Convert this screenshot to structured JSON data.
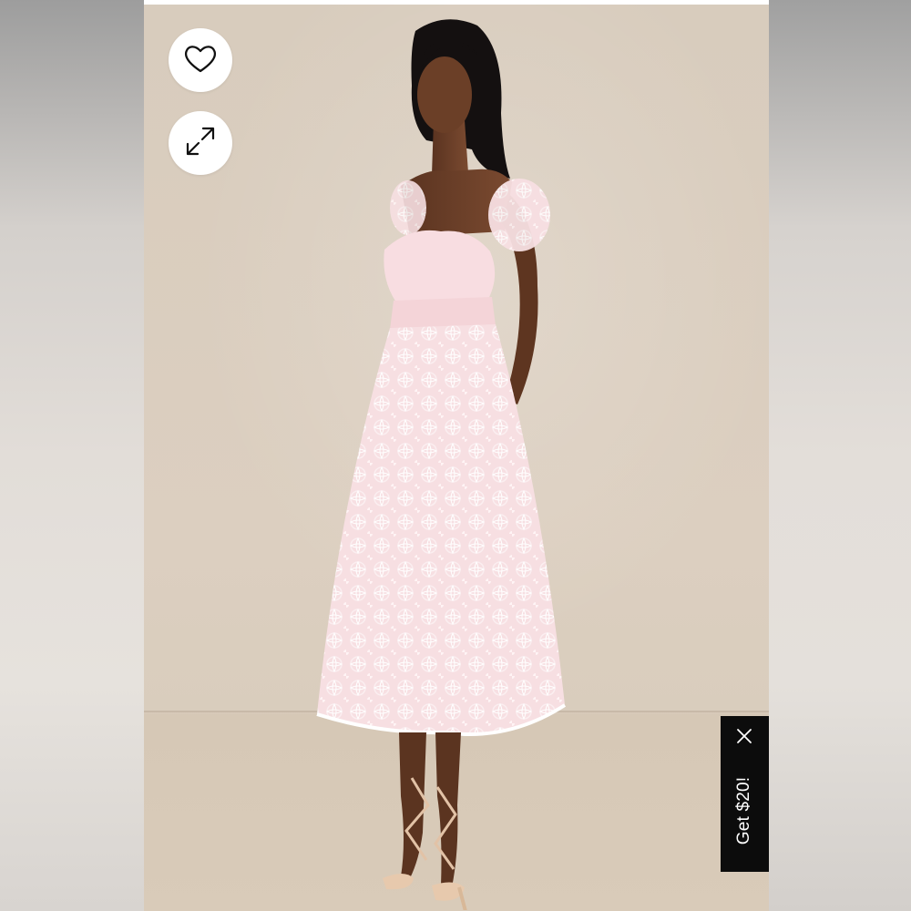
{
  "product_viewer": {
    "favorite_button": {
      "icon": "heart-icon"
    },
    "expand_button": {
      "icon": "expand-icon"
    },
    "image": {
      "subject": "model-in-pink-lace-midi-dress"
    }
  },
  "promo_tab": {
    "label": "Get $20!",
    "close_icon": "close-icon",
    "background": "#0c0c0c",
    "text_color": "#ffffff"
  },
  "colors": {
    "backdrop": "#dccfc0",
    "dress": "#f6dde0",
    "button_bg": "#ffffff"
  }
}
